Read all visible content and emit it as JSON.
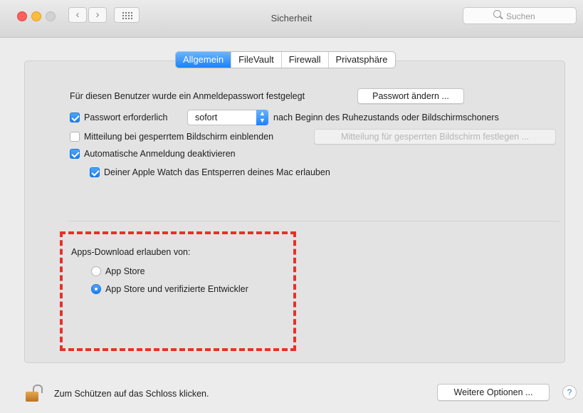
{
  "window": {
    "title": "Sicherheit"
  },
  "search": {
    "placeholder": "Suchen"
  },
  "tabs": [
    {
      "label": "Allgemein",
      "active": true
    },
    {
      "label": "FileVault",
      "active": false
    },
    {
      "label": "Firewall",
      "active": false
    },
    {
      "label": "Privatsphäre",
      "active": false
    }
  ],
  "general": {
    "password_set_text": "Für diesen Benutzer wurde ein Anmeldepasswort festgelegt",
    "change_password_button": "Passwort ändern ...",
    "require_password": {
      "label": "Passwort erforderlich",
      "checked": true
    },
    "require_password_select": "sofort",
    "require_password_suffix": "nach Beginn des Ruhezustands oder Bildschirmschoners",
    "lock_message": {
      "label": "Mitteilung bei gesperrtem Bildschirm einblenden",
      "checked": false
    },
    "lock_message_button": "Mitteilung für gesperrten Bildschirm festlegen ...",
    "disable_auto_login": {
      "label": "Automatische Anmeldung deaktivieren",
      "checked": true
    },
    "apple_watch_unlock": {
      "label": "Deiner Apple Watch das Entsperren deines Mac erlauben",
      "checked": true
    }
  },
  "downloads": {
    "heading": "Apps-Download erlauben von:",
    "options": [
      {
        "label": "App Store",
        "selected": false
      },
      {
        "label": "App Store und verifizierte Entwickler",
        "selected": true
      }
    ]
  },
  "footer": {
    "lock_text": "Zum Schützen auf das Schloss klicken.",
    "advanced_button": "Weitere Optionen ...",
    "help": "?"
  },
  "colors": {
    "accent": "#1a82fb",
    "highlight_dash": "#e8302a"
  }
}
